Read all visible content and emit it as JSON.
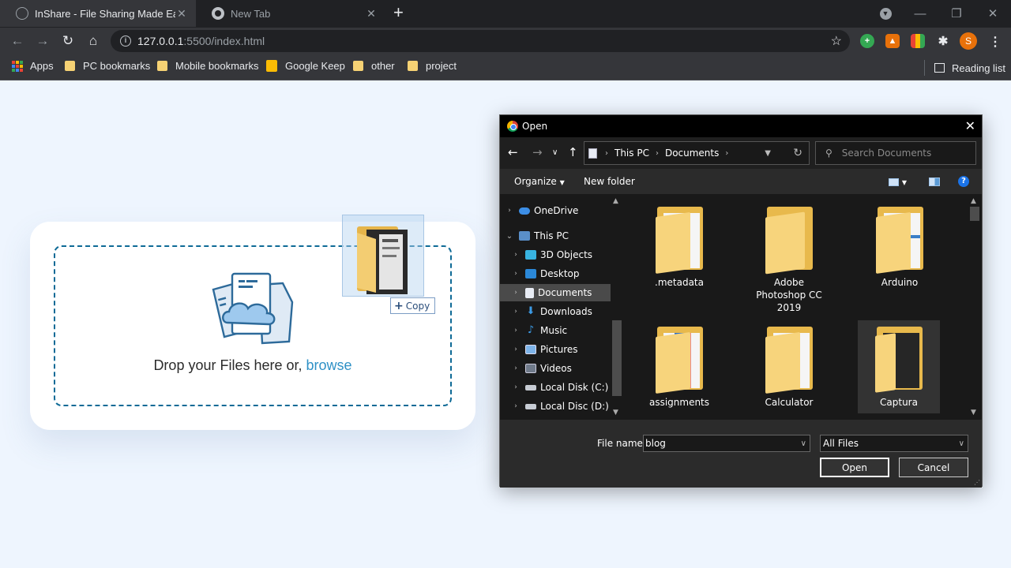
{
  "browser": {
    "tabs": [
      {
        "title": "InShare - File Sharing Made Easy",
        "active": true
      },
      {
        "title": "New Tab",
        "active": false
      }
    ],
    "url_host": "127.0.0.1",
    "url_path": ":5500/index.html",
    "bookmarks": [
      "Apps",
      "PC bookmarks",
      "Mobile bookmarks",
      "Google Keep",
      "other",
      "project"
    ],
    "reading_list": "Reading list",
    "profile_initial": "S"
  },
  "dropzone": {
    "text": "Drop your Files here or, ",
    "browse": "browse",
    "border_color": "#0e6a96",
    "link_color": "#2f91c6"
  },
  "drag": {
    "copy_label": "Copy"
  },
  "dialog": {
    "title": "Open",
    "path": [
      "This PC",
      "Documents"
    ],
    "search_placeholder": "Search Documents",
    "organize": "Organize",
    "new_folder": "New folder",
    "help": "?",
    "nav_items": [
      {
        "label": "OneDrive",
        "icon": "cloud-icon",
        "expanded": false
      },
      {
        "label": "This PC",
        "icon": "computer-icon",
        "expanded": true
      },
      {
        "label": "3D Objects",
        "icon": "cube-icon",
        "expanded": false
      },
      {
        "label": "Desktop",
        "icon": "desktop-icon",
        "expanded": false
      },
      {
        "label": "Documents",
        "icon": "documents-icon",
        "expanded": false,
        "selected": true
      },
      {
        "label": "Downloads",
        "icon": "download-icon",
        "expanded": false
      },
      {
        "label": "Music",
        "icon": "music-icon",
        "expanded": false
      },
      {
        "label": "Pictures",
        "icon": "pictures-icon",
        "expanded": false
      },
      {
        "label": "Videos",
        "icon": "videos-icon",
        "expanded": false
      },
      {
        "label": "Local Disk (C:)",
        "icon": "drive-icon",
        "expanded": false
      },
      {
        "label": "Local Disc (D:)",
        "icon": "drive-icon",
        "expanded": false
      }
    ],
    "files": [
      {
        "name": ".metadata",
        "selected": false
      },
      {
        "name": "Adobe Photoshop CC 2019",
        "selected": false
      },
      {
        "name": "Arduino",
        "selected": false
      },
      {
        "name": "assignments",
        "selected": false
      },
      {
        "name": "Calculator",
        "selected": false
      },
      {
        "name": "Captura",
        "selected": true
      }
    ],
    "file_name_label": "File name:",
    "file_name_value": "blog",
    "file_type": "All Files",
    "open_button": "Open",
    "cancel_button": "Cancel"
  }
}
